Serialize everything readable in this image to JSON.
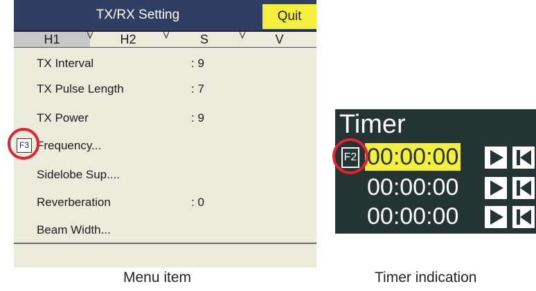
{
  "menu": {
    "title": "TX/RX Setting",
    "quit_label": "Quit",
    "tabs": [
      "H1",
      "H2",
      "S",
      "V"
    ],
    "active_tab": "H1",
    "items": [
      {
        "label": "TX Interval",
        "value": ": 9"
      },
      {
        "label": "TX Pulse Length",
        "value": ": 7"
      },
      {
        "label": "TX Power",
        "value": ": 9"
      },
      {
        "label": "Frequency...",
        "value": ""
      },
      {
        "label": "Sidelobe Sup....",
        "value": ""
      },
      {
        "label": "Reverberation",
        "value": ": 0"
      },
      {
        "label": "Beam Width...",
        "value": ""
      }
    ],
    "function_key": "F3"
  },
  "timer": {
    "title": "Timer",
    "function_key": "F2",
    "rows": [
      {
        "time": "00:00:00",
        "highlighted": true
      },
      {
        "time": "00:00:00",
        "highlighted": false
      },
      {
        "time": "00:00:00",
        "highlighted": false
      }
    ],
    "play_icon": "play-icon",
    "reset_icon": "reset-icon"
  },
  "captions": {
    "menu": "Menu item",
    "timer": "Timer indication"
  },
  "colors": {
    "title_bar": "#2e3f63",
    "quit_bg": "#f3ef3c",
    "menu_bg": "#ebebdc",
    "timer_bg": "#243432",
    "timer_highlight": "#f3ef3c",
    "callout_circle": "#e4232f"
  }
}
